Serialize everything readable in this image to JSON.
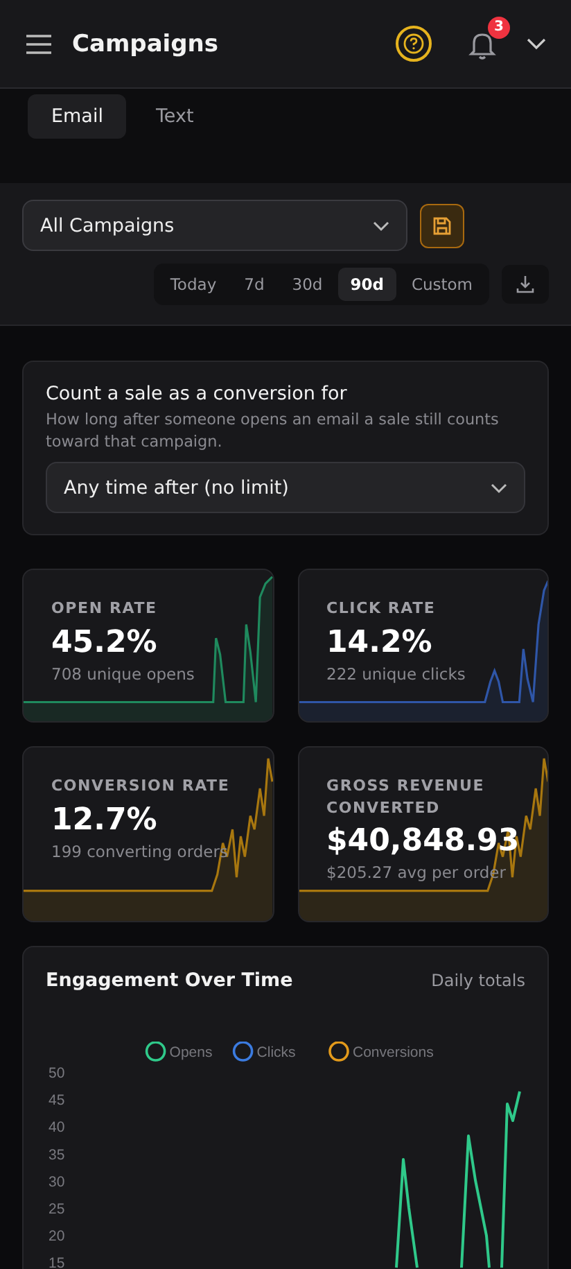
{
  "header": {
    "title": "Campaigns",
    "notification_count": "3"
  },
  "tabs": [
    {
      "label": "Email",
      "selected": true
    },
    {
      "label": "Text",
      "selected": false
    }
  ],
  "campaign_select": {
    "value": "All Campaigns"
  },
  "ranges": [
    {
      "label": "Today",
      "selected": false
    },
    {
      "label": "7d",
      "selected": false
    },
    {
      "label": "30d",
      "selected": false
    },
    {
      "label": "90d",
      "selected": true
    },
    {
      "label": "Custom",
      "selected": false
    }
  ],
  "conversion_window": {
    "title": "Count a sale as a conversion for",
    "description": "How long after someone opens an email a sale still counts toward that campaign.",
    "value": "Any time after (no limit)"
  },
  "metrics": [
    {
      "label": "OPEN RATE",
      "value": "45.2%",
      "detail": "708 unique opens",
      "color": "#1f8a5e"
    },
    {
      "label": "CLICK RATE",
      "value": "14.2%",
      "detail": "222 unique clicks",
      "color": "#2f56a8"
    },
    {
      "label": "CONVERSION RATE",
      "value": "12.7%",
      "detail": "199 converting orders",
      "color": "#a8770f"
    },
    {
      "label": "GROSS REVENUE CONVERTED",
      "value": "$40,848.93",
      "detail": "$205.27 avg per order",
      "color": "#a8770f"
    }
  ],
  "engagement": {
    "title": "Engagement Over Time",
    "subtitle": "Daily totals",
    "legend": [
      {
        "name": "Opens",
        "color": "#2fc98a"
      },
      {
        "name": "Clicks",
        "color": "#3b7be0"
      },
      {
        "name": "Conversions",
        "color": "#e39a1b"
      }
    ],
    "y_labels": [
      "50",
      "45",
      "40",
      "35",
      "30",
      "25",
      "20",
      "15"
    ]
  }
}
